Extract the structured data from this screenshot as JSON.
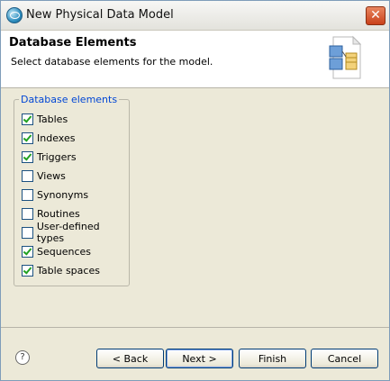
{
  "window": {
    "title": "New Physical Data Model",
    "close_symbol": "✕"
  },
  "header": {
    "title": "Database Elements",
    "description": "Select database elements for the model."
  },
  "group": {
    "label": "Database elements",
    "items": [
      {
        "label": "Tables",
        "checked": true
      },
      {
        "label": "Indexes",
        "checked": true
      },
      {
        "label": "Triggers",
        "checked": true
      },
      {
        "label": "Views",
        "checked": false
      },
      {
        "label": "Synonyms",
        "checked": false
      },
      {
        "label": "Routines",
        "checked": false
      },
      {
        "label": "User-defined types",
        "checked": false
      },
      {
        "label": "Sequences",
        "checked": true
      },
      {
        "label": "Table spaces",
        "checked": true
      }
    ]
  },
  "buttons": {
    "help": "?",
    "back": "< Back",
    "next": "Next >",
    "finish": "Finish",
    "cancel": "Cancel"
  },
  "colors": {
    "accent": "#0046d5",
    "check": "#21a121"
  }
}
